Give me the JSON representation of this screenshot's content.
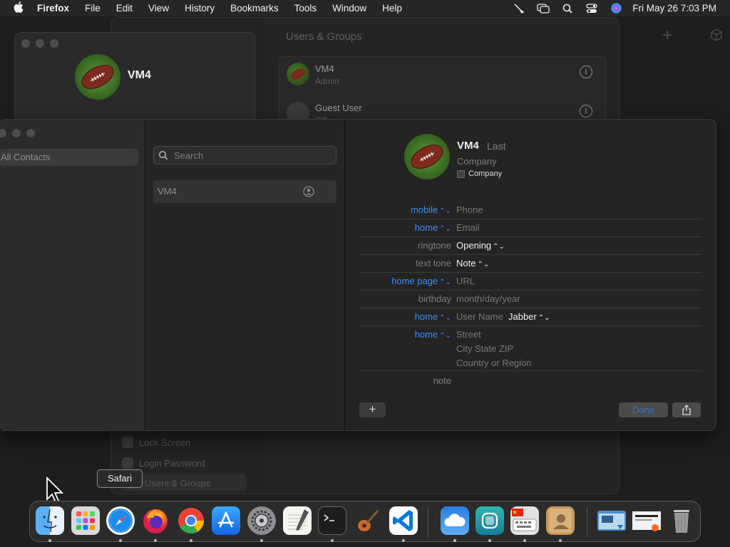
{
  "menubar": {
    "app_name": "Firefox",
    "menus": [
      "File",
      "Edit",
      "View",
      "History",
      "Bookmarks",
      "Tools",
      "Window",
      "Help"
    ],
    "clock": "Fri May 26  7:03 PM"
  },
  "settings": {
    "pane_title": "Users & Groups",
    "users": [
      {
        "name": "VM4",
        "role": "Admin"
      },
      {
        "name": "Guest User",
        "role": "Off"
      }
    ],
    "sidebar": [
      "Lock Screen",
      "Login Password",
      "Users & Groups"
    ]
  },
  "user_window": {
    "name": "VM4"
  },
  "contacts": {
    "group": "All Contacts",
    "search_placeholder": "Search",
    "list": [
      "VM4"
    ],
    "card": {
      "first_name": "VM4",
      "last_name": "Last",
      "company_placeholder": "Company",
      "company_checkbox": "Company",
      "fields": [
        {
          "label": "mobile",
          "value": "Phone"
        },
        {
          "label": "home",
          "value": "Email"
        },
        {
          "label": "ringtone",
          "value": "Opening"
        },
        {
          "label": "text tone",
          "value": "Note"
        },
        {
          "label": "home page",
          "value": "URL"
        },
        {
          "label": "birthday",
          "value": "month/day/year"
        },
        {
          "label": "home",
          "value": "User Name",
          "extra": "Jabber"
        },
        {
          "label": "home",
          "value": "Street",
          "line2": "City  State  ZIP",
          "line3": "Country or Region"
        },
        {
          "label": "note",
          "value": ""
        }
      ],
      "add_label": "+",
      "done_label": "Done"
    }
  },
  "tooltip": "Safari",
  "dock": {
    "apps": [
      "Finder",
      "Launchpad",
      "Safari",
      "Firefox",
      "Chrome",
      "App Store",
      "System Settings",
      "TextEdit",
      "Terminal",
      "Instruments",
      "Visual Studio Code",
      "Weather",
      "Screen Sharing",
      "Preview",
      "Contacts",
      "Downloads",
      "Documents",
      "Trash"
    ]
  }
}
